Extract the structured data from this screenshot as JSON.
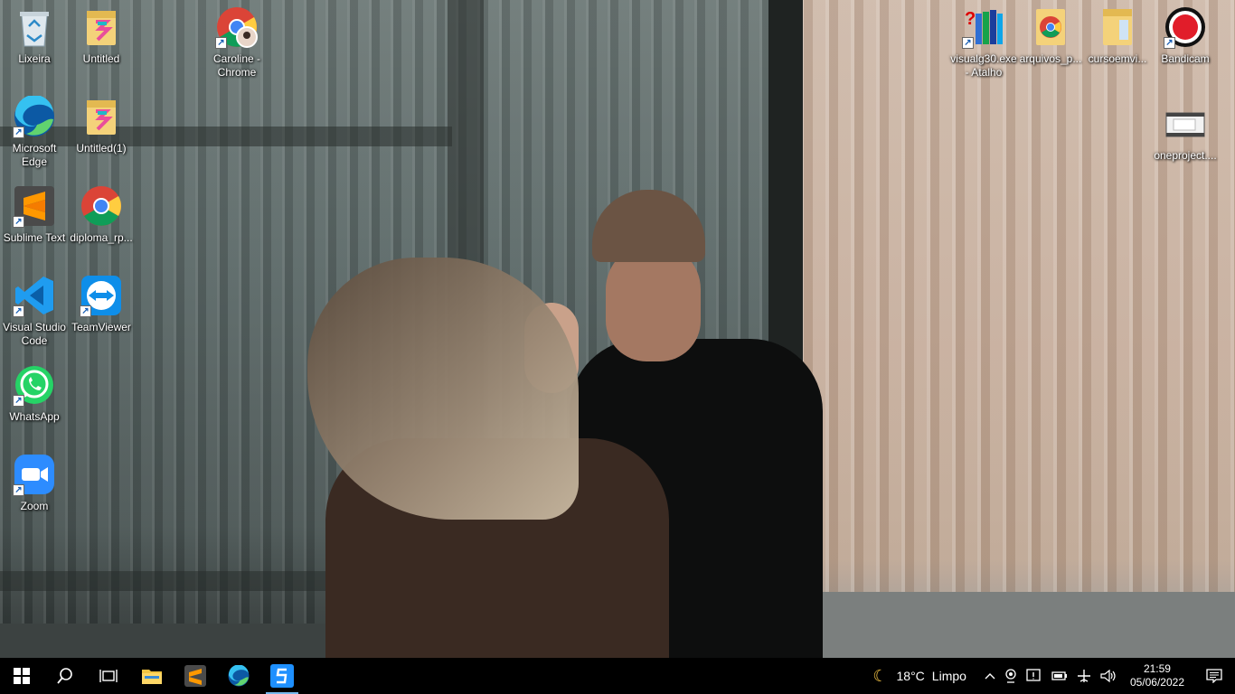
{
  "desktop": {
    "icons": [
      {
        "label": "Lixeira",
        "icon": "recycle-bin-icon"
      },
      {
        "label": "Untitled",
        "icon": "folder-icon"
      },
      {
        "label": "Caroline - Chrome",
        "icon": "chrome-profile-icon"
      },
      {
        "label": "Microsoft Edge",
        "icon": "edge-icon"
      },
      {
        "label": "Untitled(1)",
        "icon": "folder-icon"
      },
      {
        "label": "Sublime Text",
        "icon": "sublime-text-icon"
      },
      {
        "label": "diploma_rp...",
        "icon": "chrome-icon"
      },
      {
        "label": "Visual Studio Code",
        "icon": "vscode-icon"
      },
      {
        "label": "TeamViewer",
        "icon": "teamviewer-icon"
      },
      {
        "label": "WhatsApp",
        "icon": "whatsapp-icon"
      },
      {
        "label": "Zoom",
        "icon": "zoom-icon"
      },
      {
        "label": "visualg30.exe - Atalho",
        "icon": "visualg-icon"
      },
      {
        "label": "arquivos_p...",
        "icon": "chrome-icon"
      },
      {
        "label": "cursoemvi...",
        "icon": "folder-icon"
      },
      {
        "label": "Bandicam",
        "icon": "bandicam-icon"
      },
      {
        "label": "oneproject....",
        "icon": "video-file-icon"
      }
    ]
  },
  "taskbar": {
    "pinned": [
      {
        "name": "start-button",
        "icon": "windows-logo-icon"
      },
      {
        "name": "search-button",
        "icon": "search-icon"
      },
      {
        "name": "task-view-button",
        "icon": "task-view-icon"
      },
      {
        "name": "file-explorer-button",
        "icon": "folder-icon"
      },
      {
        "name": "sublime-text-button",
        "icon": "sublime-text-icon"
      },
      {
        "name": "edge-button",
        "icon": "edge-icon"
      },
      {
        "name": "snipping-app-button",
        "icon": "app-s-icon"
      }
    ],
    "weather": {
      "temp": "18°C",
      "condition": "Limpo",
      "icon": "moon-icon"
    },
    "clock": {
      "time": "21:59",
      "date": "05/06/2022"
    }
  },
  "colors": {
    "taskbar": "#000000",
    "accent": "#76b9ed"
  }
}
